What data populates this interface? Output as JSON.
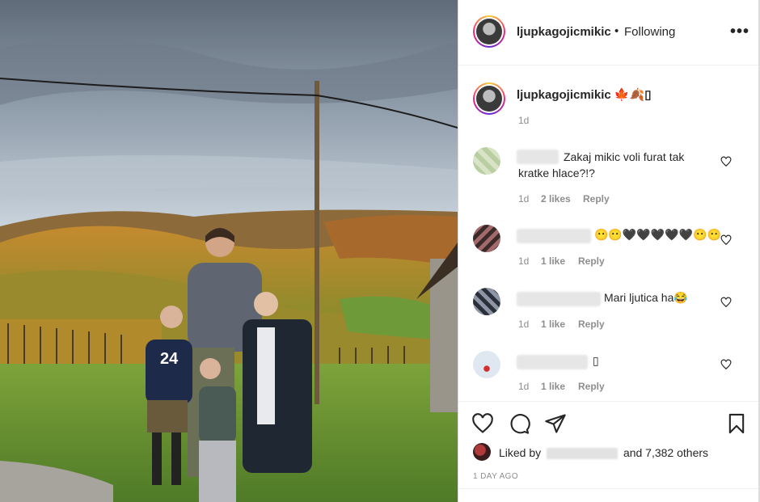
{
  "post": {
    "username": "ljupkagojicmikic",
    "follow_separator": "•",
    "follow_status": "Following",
    "more_label": "•••",
    "caption_text": "ljupkagojicmikic 🍁🍂▯",
    "caption_time": "1d"
  },
  "comments": [
    {
      "text_line1": "Zakaj mikic voli furat tak",
      "text_line2": "kratke hlace?!?",
      "time": "1d",
      "likes": "2 likes",
      "reply": "Reply"
    },
    {
      "text_line1": "😶😶🖤🖤🖤🖤🖤😶😶",
      "time": "1d",
      "likes": "1 like",
      "reply": "Reply"
    },
    {
      "text_line1": "Mari ljutica ha😂",
      "time": "1d",
      "likes": "1 like",
      "reply": "Reply"
    },
    {
      "text_line1": "▯",
      "time": "1d",
      "likes": "1 like",
      "reply": "Reply"
    }
  ],
  "likes": {
    "prefix": "Liked by",
    "suffix": "and 7,382 others"
  },
  "post_date": "1 DAY AGO",
  "icons": {
    "like": "heart-icon",
    "comment": "comment-icon",
    "share": "share-icon",
    "save": "bookmark-icon",
    "more": "more-icon"
  },
  "colors": {
    "text": "#262626",
    "muted": "#8e8e8e",
    "border": "#efefef"
  }
}
